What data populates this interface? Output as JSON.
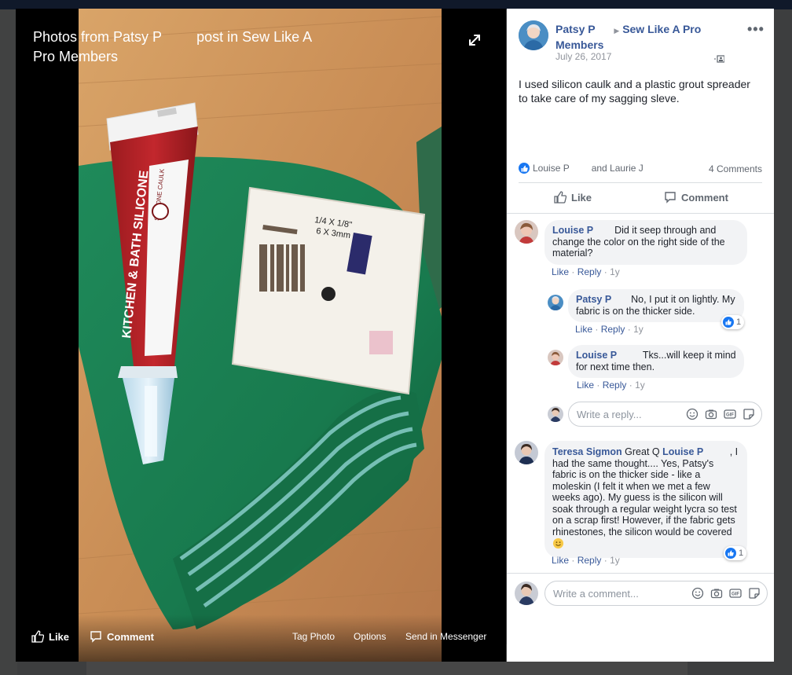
{
  "stage": {
    "title_part1": "Photos from Patsy P",
    "title_part2": "post in Sew Like A Pro Members",
    "like_label": "Like",
    "comment_label": "Comment",
    "tag_photo_label": "Tag Photo",
    "options_label": "Options",
    "send_label": "Send in Messenger"
  },
  "photo": {
    "caulk_brand_text": "KITCHEN & BATH SILICONE",
    "caulk_sub_text": "SILICONE CAULK",
    "spreader_size_text": "1/4 X 1/8\"",
    "spreader_size2_text": "6 X 3mm"
  },
  "post": {
    "author": "Patsy P",
    "group": "Sew Like A Pro Members",
    "date": "July 26, 2017",
    "text": "I used silicon caulk and a plastic grout spreader to take care of my sagging sleve.",
    "reactors_a": "Louise P",
    "reactors_b": "and Laurie J",
    "comments_count": "4 Comments",
    "like_label": "Like",
    "comment_label": "Comment"
  },
  "comments": [
    {
      "author": "Louise P",
      "text": "Did it seep through and change the color on the right side of the material?",
      "like": "Like",
      "reply": "Reply",
      "time": "1y"
    },
    {
      "author": "Patsy P",
      "text": "No, I put it on lightly. My fabric is on the thicker side.",
      "like": "Like",
      "reply": "Reply",
      "time": "1y",
      "reactions": "1"
    },
    {
      "author": "Louise P",
      "text": "Tks...will keep it mind for next time then.",
      "like": "Like",
      "reply": "Reply",
      "time": "1y"
    },
    {
      "author": "Teresa Sigmon",
      "text_lead": "Great Q",
      "mention": "Louise P",
      "text": ", I had the same thought.... Yes, Patsy's fabric is on the thicker side - like a moleskin (I felt it when we met a few weeks ago). My guess is the silicon will soak through a regular weight lycra so test on a scrap first! However, if the fabric gets rhinestones, the silicon would be covered",
      "like": "Like",
      "reply": "Reply",
      "time": "1y",
      "reactions": "1"
    }
  ],
  "reply_input": {
    "placeholder": "Write a reply..."
  },
  "comment_input": {
    "placeholder": "Write a comment..."
  },
  "colors": {
    "link": "#385898",
    "like_blue": "#1877f2",
    "panel_bg": "#ffffff",
    "stage_bg": "#000000"
  }
}
